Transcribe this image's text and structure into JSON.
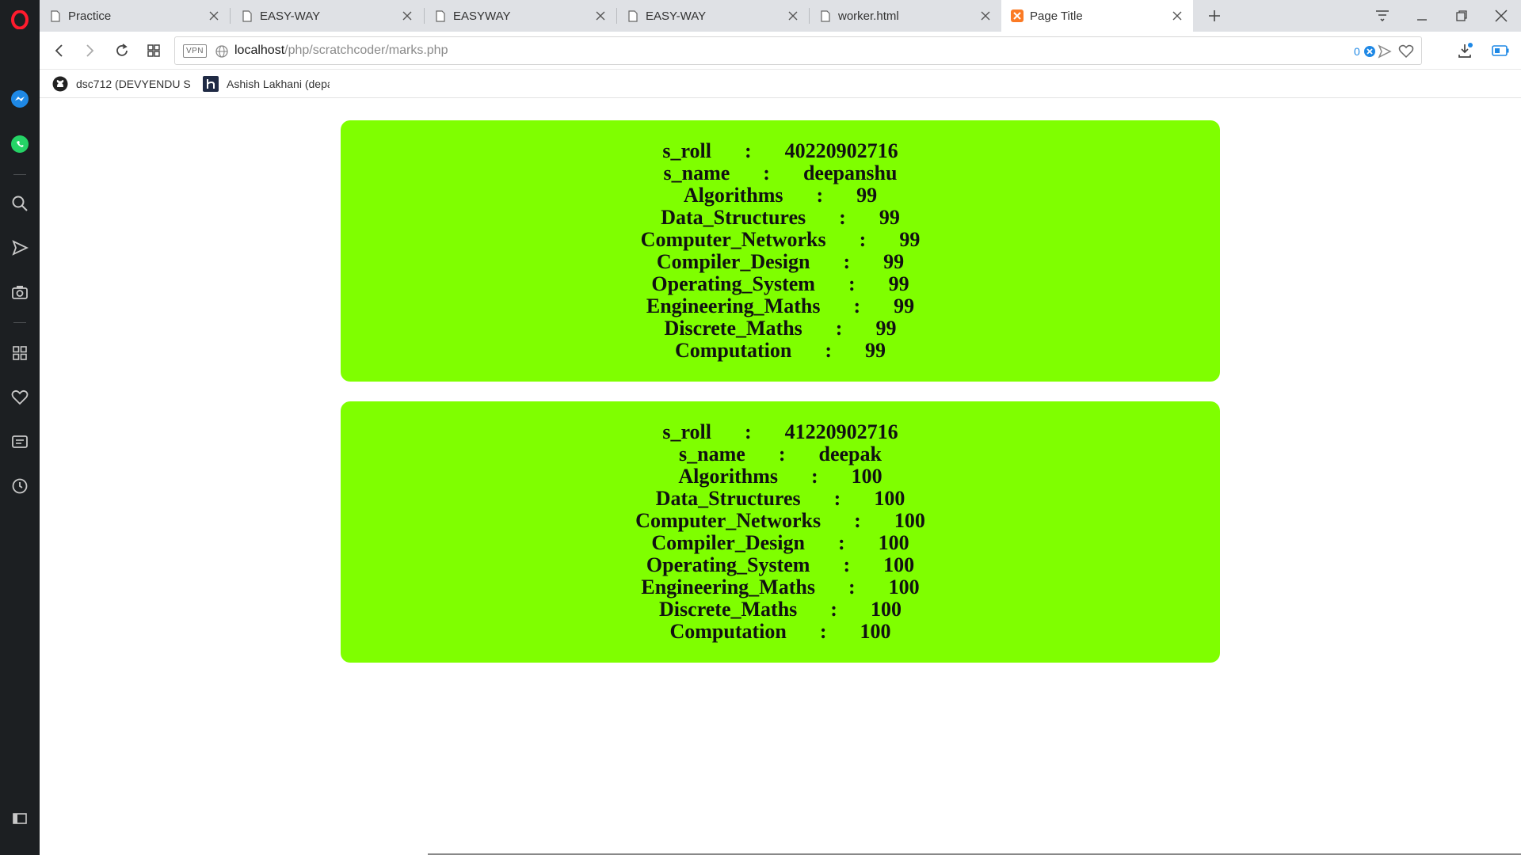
{
  "tabs": [
    {
      "label": "Practice",
      "icon": "page-icon"
    },
    {
      "label": "EASY-WAY",
      "icon": "page-icon"
    },
    {
      "label": "EASYWAY",
      "icon": "page-icon"
    },
    {
      "label": "EASY-WAY",
      "icon": "page-icon"
    },
    {
      "label": "worker.html",
      "icon": "page-icon"
    },
    {
      "label": "Page Title",
      "icon": "xampp-icon",
      "active": true
    }
  ],
  "address": {
    "vpn": "VPN",
    "host": "localhost",
    "path": "/php/scratchcoder/marks.php",
    "badge_count": "0"
  },
  "bookmarks": [
    {
      "label": "dsc712 (DEVYENDU S",
      "icon": "github-icon"
    },
    {
      "label": "Ashish Lakhani (depa",
      "icon": "hashnode-icon"
    }
  ],
  "students": [
    {
      "rows": [
        {
          "key": "s_roll",
          "value": "40220902716"
        },
        {
          "key": "s_name",
          "value": "deepanshu"
        },
        {
          "key": "Algorithms",
          "value": "99"
        },
        {
          "key": "Data_Structures",
          "value": "99"
        },
        {
          "key": "Computer_Networks",
          "value": "99"
        },
        {
          "key": "Compiler_Design",
          "value": "99"
        },
        {
          "key": "Operating_System",
          "value": "99"
        },
        {
          "key": "Engineering_Maths",
          "value": "99"
        },
        {
          "key": "Discrete_Maths",
          "value": "99"
        },
        {
          "key": "Computation",
          "value": "99"
        }
      ]
    },
    {
      "rows": [
        {
          "key": "s_roll",
          "value": "41220902716"
        },
        {
          "key": "s_name",
          "value": "deepak"
        },
        {
          "key": "Algorithms",
          "value": "100"
        },
        {
          "key": "Data_Structures",
          "value": "100"
        },
        {
          "key": "Computer_Networks",
          "value": "100"
        },
        {
          "key": "Compiler_Design",
          "value": "100"
        },
        {
          "key": "Operating_System",
          "value": "100"
        },
        {
          "key": "Engineering_Maths",
          "value": "100"
        },
        {
          "key": "Discrete_Maths",
          "value": "100"
        },
        {
          "key": "Computation",
          "value": "100"
        }
      ]
    }
  ],
  "separator": ":",
  "colors": {
    "card_background": "#7fff00",
    "sidebar_background": "#1c1f22",
    "opera_red": "#ff1b2d"
  }
}
